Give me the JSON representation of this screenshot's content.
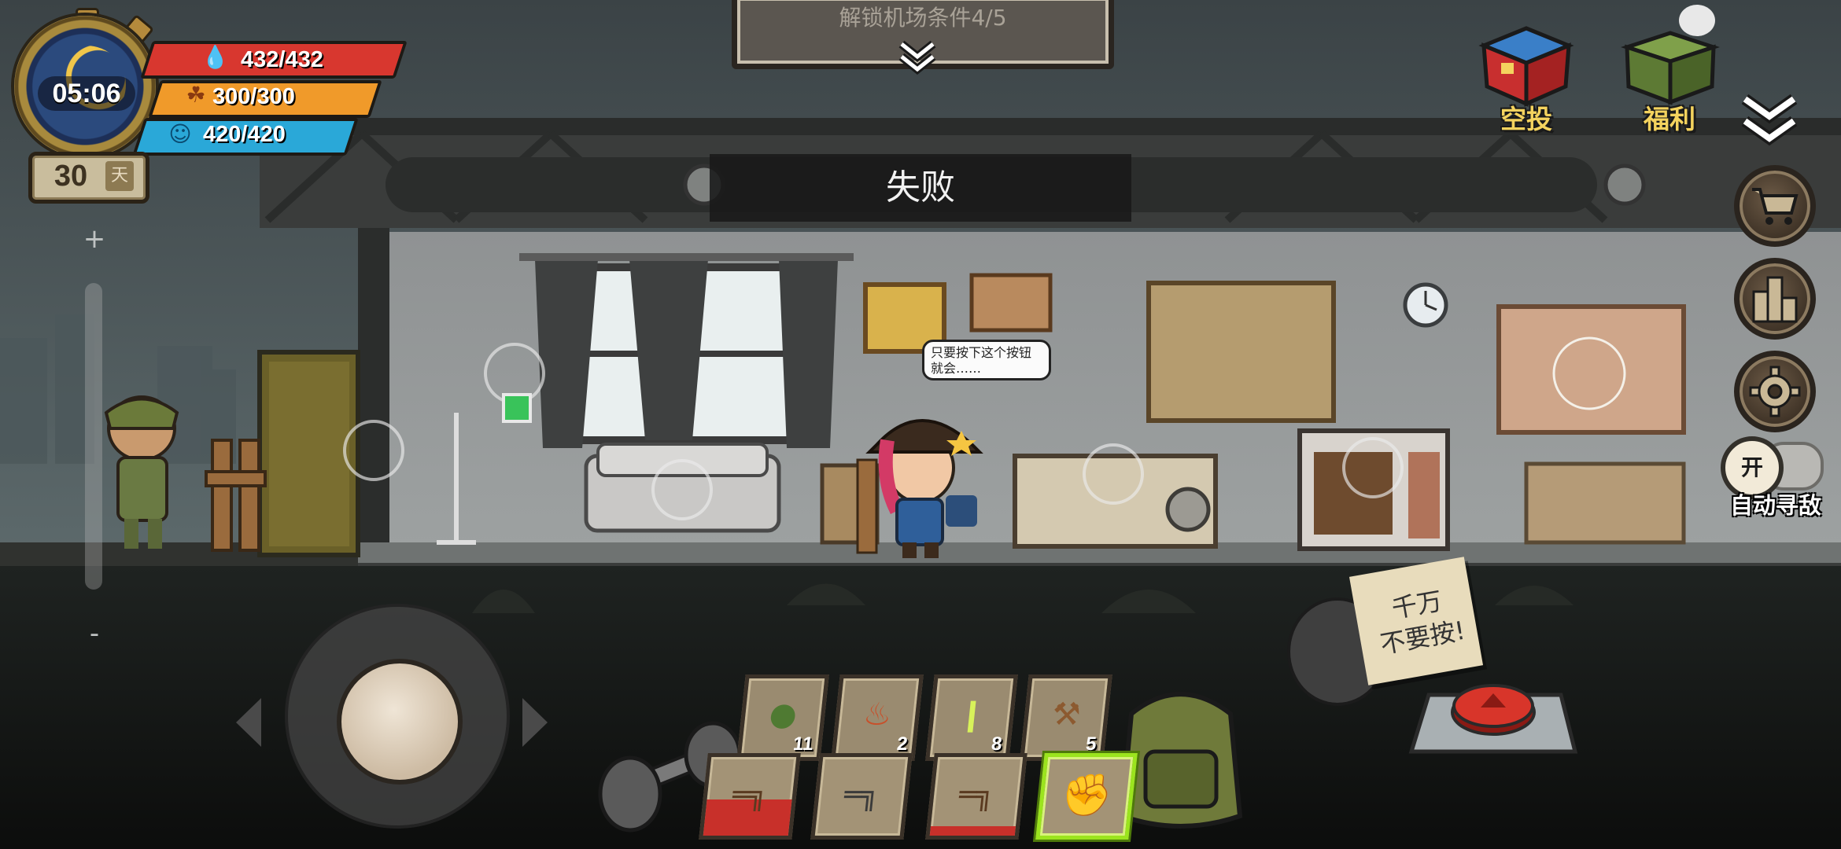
{
  "hud": {
    "clock_time": "05:06",
    "health": "432/432",
    "hunger": "300/300",
    "water": "420/420",
    "day_number": "30",
    "day_unit": "天",
    "health_color": "#d8372f",
    "hunger_color": "#f09a2a",
    "water_color": "#2aa8d8"
  },
  "banner": {
    "unlock_text": "解锁机场条件4/5"
  },
  "toast": {
    "message": "失败"
  },
  "top_right": {
    "airdrop_label": "空投",
    "welfare_label": "福利"
  },
  "right_menu": {
    "shop_icon": "cart-icon",
    "ranking_icon": "podium-icon",
    "settings_icon": "gear-icon",
    "auto_toggle_label": "开",
    "auto_search_label": "自动寻敌"
  },
  "bubble": {
    "line1": "只要按下这个按钮",
    "line2": "就会……"
  },
  "zoom": {
    "plus": "+",
    "minus": "-"
  },
  "inventory": {
    "consumables": [
      {
        "icon": "grenade-icon",
        "count": "11"
      },
      {
        "icon": "molotov-icon",
        "count": "2"
      },
      {
        "icon": "glowstick-icon",
        "count": "8"
      },
      {
        "icon": "barricade-icon",
        "count": "5"
      }
    ],
    "weapons": [
      {
        "icon": "assault-rifle-icon"
      },
      {
        "icon": "rifle-icon"
      },
      {
        "icon": "shotgun-icon"
      },
      {
        "icon": "fist-icon",
        "selected": true
      }
    ]
  },
  "note": {
    "text_line1": "千万",
    "text_line2": "不要按!"
  }
}
